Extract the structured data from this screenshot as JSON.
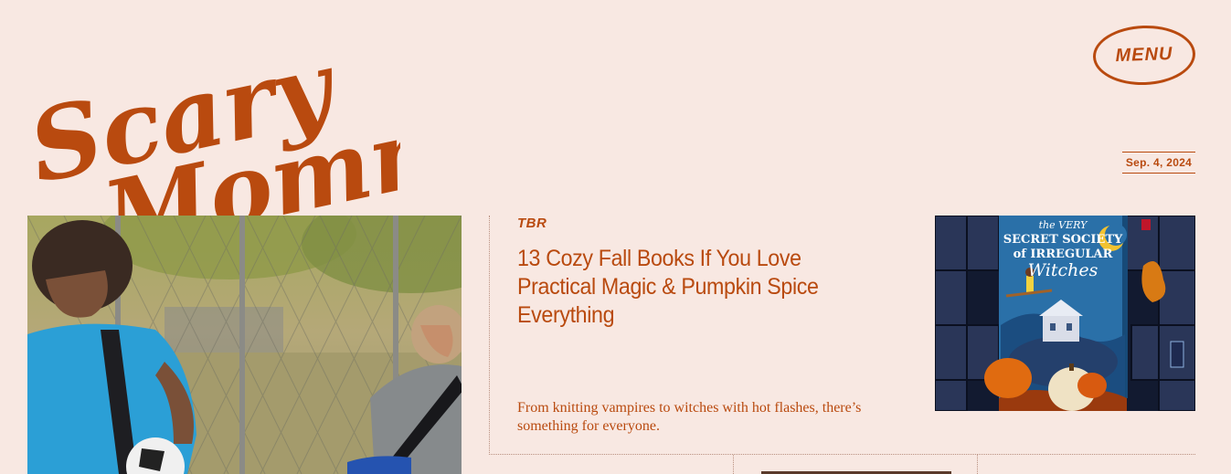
{
  "brand": {
    "line1": "Scary",
    "line2": "Mommy",
    "color": "#b94a0f"
  },
  "header": {
    "menu_label": "MENU",
    "date": "Sep. 4, 2024"
  },
  "article": {
    "category": "TBR",
    "headline": "13 Cozy Fall Books If You Love Practical Magic & Pumpkin Spice Everything",
    "dek": "From knitting vampires to witches with hot flashes, there’s something for everyone."
  },
  "thumbnail": {
    "cover_line1": "the VERY",
    "cover_line2": "SECRET SOCIETY",
    "cover_line3": "of IRREGULAR",
    "cover_line4": "Witches"
  },
  "colors": {
    "background": "#f8e8e2",
    "accent": "#b94a0f"
  }
}
